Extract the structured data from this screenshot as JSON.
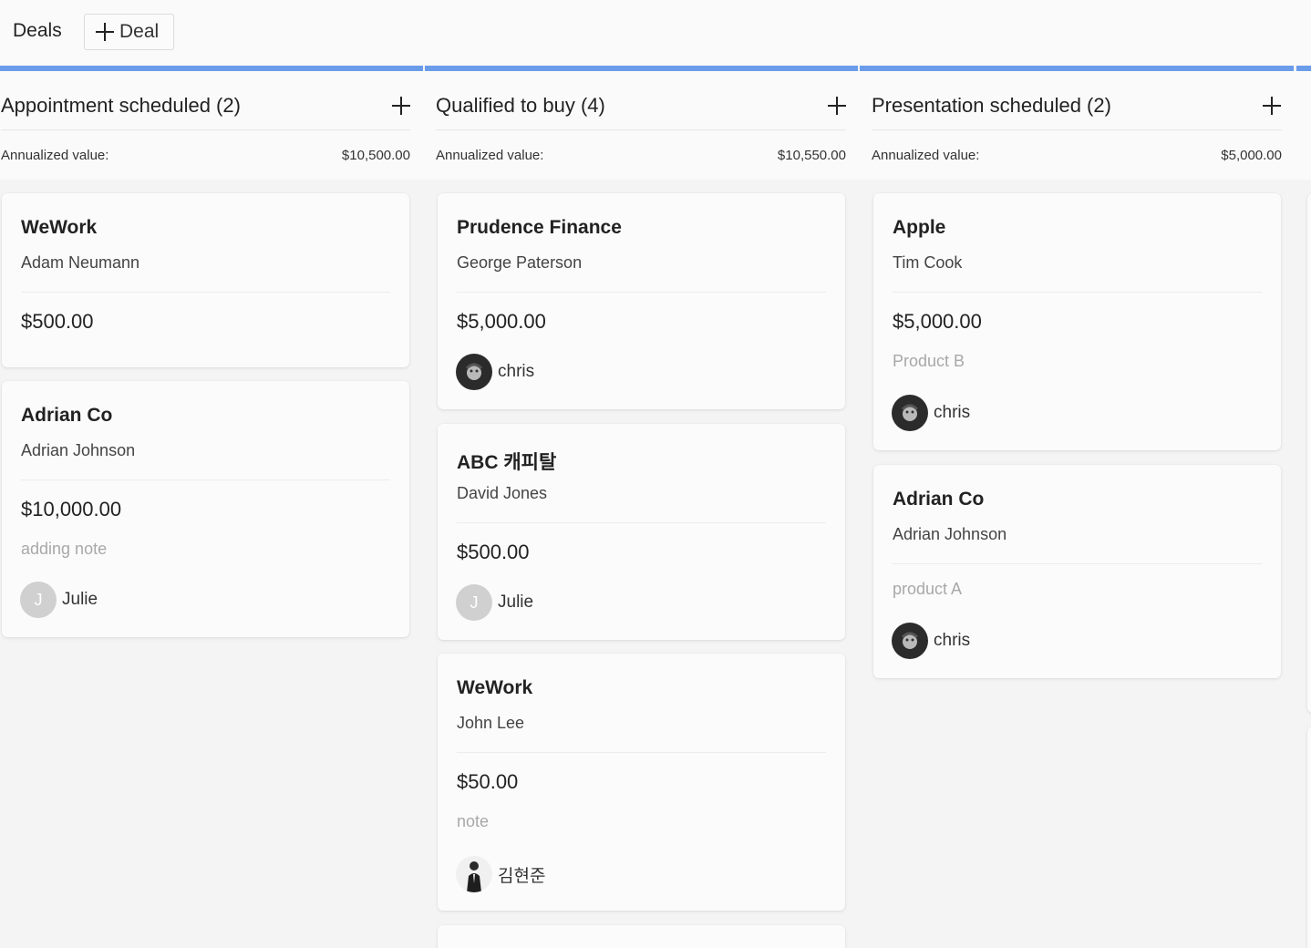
{
  "header": {
    "title": "Deals",
    "add_deal_label": "Deal"
  },
  "columns": [
    {
      "title": "Appointment scheduled (2)",
      "annualized_label": "Annualized value:",
      "annualized_value": "$10,500.00",
      "cards": [
        {
          "company": "WeWork",
          "contact": "Adam Neumann",
          "amount": "$500.00"
        },
        {
          "company": "Adrian Co",
          "contact": "Adrian Johnson",
          "amount": "$10,000.00",
          "note": "adding note",
          "owner": {
            "name": "Julie",
            "initial": "J"
          }
        }
      ]
    },
    {
      "title": "Qualified to buy (4)",
      "annualized_label": "Annualized value:",
      "annualized_value": "$10,550.00",
      "cards": [
        {
          "company": "Prudence Finance",
          "contact": "George Paterson",
          "amount": "$5,000.00",
          "owner": {
            "name": "chris"
          }
        },
        {
          "company": "ABC 캐피탈",
          "contact": "David Jones",
          "amount": "$500.00",
          "owner": {
            "name": "Julie",
            "initial": "J"
          }
        },
        {
          "company": "WeWork",
          "contact": "John Lee",
          "amount": "$50.00",
          "note": "note",
          "owner": {
            "name": "김현준"
          }
        }
      ]
    },
    {
      "title": "Presentation scheduled (2)",
      "annualized_label": "Annualized value:",
      "annualized_value": "$5,000.00",
      "cards": [
        {
          "company": "Apple",
          "contact": "Tim Cook",
          "amount": "$5,000.00",
          "note": "Product B",
          "owner": {
            "name": "chris"
          }
        },
        {
          "company": "Adrian Co",
          "contact": "Adrian Johnson",
          "note": "product A",
          "owner": {
            "name": "chris"
          }
        }
      ]
    }
  ],
  "icons": {
    "plus": "plus-icon",
    "avatar_photo": "user-photo-avatar"
  },
  "colors": {
    "column_accent": "#6b9cea",
    "background": "#f4f4f4",
    "card": "#fbfbfb",
    "note_text": "#a8a8a8"
  }
}
